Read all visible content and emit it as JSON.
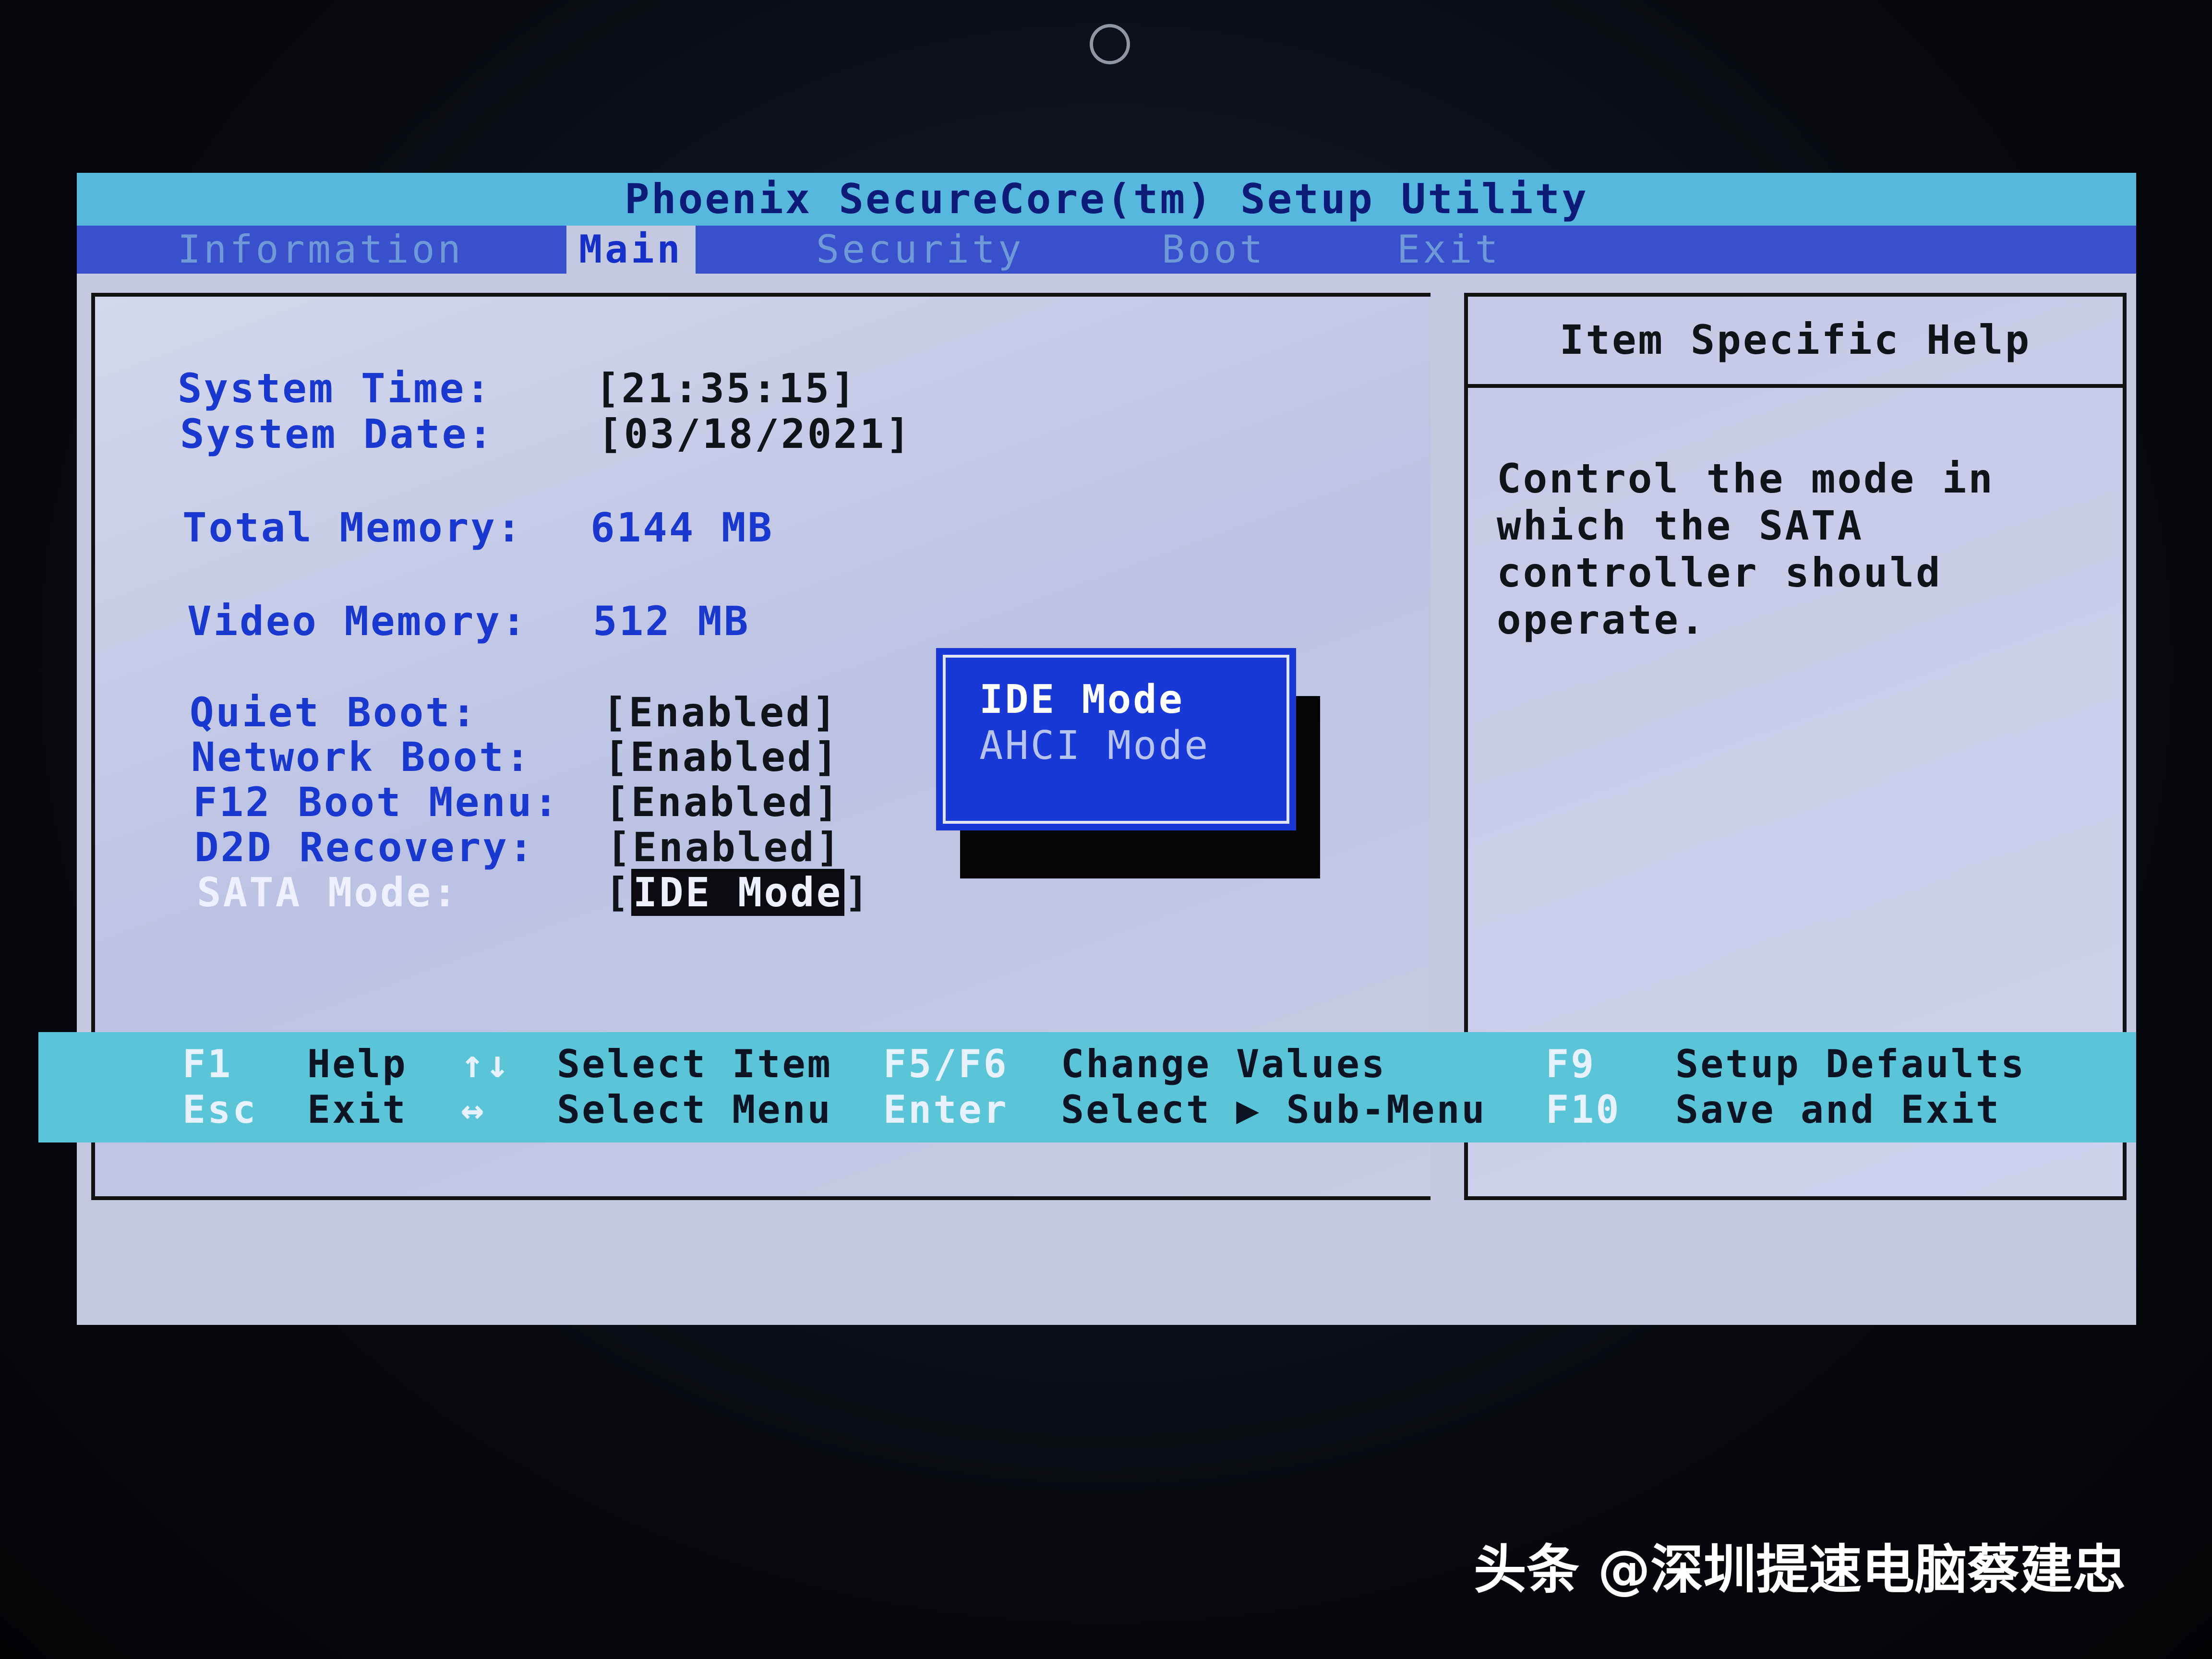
{
  "title": "Phoenix SecureCore(tm) Setup Utility",
  "menu": [
    {
      "label": "Information",
      "active": false
    },
    {
      "label": "Main",
      "active": true
    },
    {
      "label": "Security",
      "active": false
    },
    {
      "label": "Boot",
      "active": false
    },
    {
      "label": "Exit",
      "active": false
    }
  ],
  "settings": {
    "system_time": {
      "label": "System Time:",
      "value": "[21:35:15]"
    },
    "system_date": {
      "label": "System Date:",
      "value": "[03/18/2021]"
    },
    "total_memory": {
      "label": "Total Memory:",
      "value": "6144 MB"
    },
    "video_memory": {
      "label": "Video Memory:",
      "value": "512 MB"
    },
    "quiet_boot": {
      "label": "Quiet Boot:",
      "value": "[Enabled]"
    },
    "network_boot": {
      "label": "Network Boot:",
      "value": "[Enabled]"
    },
    "f12_boot_menu": {
      "label": "F12 Boot Menu:",
      "value": "[Enabled]"
    },
    "d2d_recovery": {
      "label": "D2D Recovery:",
      "value": "[Enabled]"
    },
    "sata_mode": {
      "label": "SATA Mode:",
      "value_open": "[",
      "value": "IDE Mode",
      "value_close": "]"
    }
  },
  "popup": {
    "options": [
      "IDE Mode",
      "AHCI Mode"
    ],
    "selected": "IDE Mode"
  },
  "help": {
    "title": "Item Specific Help",
    "lines": [
      "Control the mode in",
      "which the SATA",
      "controller should",
      "operate."
    ]
  },
  "footer": {
    "row1": [
      {
        "key": "F1",
        "desc": "Help"
      },
      {
        "key": "↑↓",
        "desc": "Select Item"
      },
      {
        "key": "F5/F6",
        "desc": "Change Values"
      },
      {
        "key": "F9",
        "desc": "Setup Defaults"
      }
    ],
    "row2": [
      {
        "key": "Esc",
        "desc": "Exit"
      },
      {
        "key": "↔",
        "desc": "Select Menu"
      },
      {
        "key": "Enter",
        "desc": "Select ▶ Sub-Menu"
      },
      {
        "key": "F10",
        "desc": "Save and Exit"
      }
    ]
  },
  "watermark": "头条 @深圳提速电脑蔡建忠",
  "colors": {
    "title_bar": "#55b8dc",
    "menu_bar": "#3850cc",
    "screen_bg": "#c4c8e0",
    "label_blue": "#1838d0",
    "popup_bg": "#1838d8",
    "footer_bg": "#5ac4d8"
  }
}
